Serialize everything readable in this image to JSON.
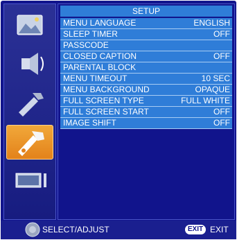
{
  "menu": {
    "title": "SETUP",
    "items": [
      {
        "label": "MENU LANGUAGE",
        "value": "ENGLISH"
      },
      {
        "label": "SLEEP TIMER",
        "value": "OFF"
      },
      {
        "label": "PASSCODE",
        "value": ""
      },
      {
        "label": "CLOSED CAPTION",
        "value": "OFF"
      },
      {
        "label": "PARENTAL BLOCK",
        "value": ""
      },
      {
        "label": "MENU TIMEOUT",
        "value": "10 SEC"
      },
      {
        "label": "MENU BACKGROUND",
        "value": "OPAQUE"
      },
      {
        "label": "FULL SCREEN TYPE",
        "value": "FULL WHITE"
      },
      {
        "label": "FULL SCREEN START",
        "value": "OFF"
      },
      {
        "label": "IMAGE SHIFT",
        "value": "OFF"
      }
    ]
  },
  "sidebar": {
    "icons": [
      {
        "name": "picture-icon",
        "active": false
      },
      {
        "name": "audio-icon",
        "active": false
      },
      {
        "name": "tools-icon",
        "active": false
      },
      {
        "name": "setup-icon",
        "active": true
      },
      {
        "name": "input-icon",
        "active": false
      }
    ]
  },
  "footer": {
    "hint": "SELECT/ADJUST",
    "exit_key": "EXIT",
    "exit_label": "EXIT"
  },
  "colors": {
    "background": "#11148c",
    "row": "#2f7dd8",
    "active_icon": "#e8901f",
    "text": "#ffffff"
  }
}
